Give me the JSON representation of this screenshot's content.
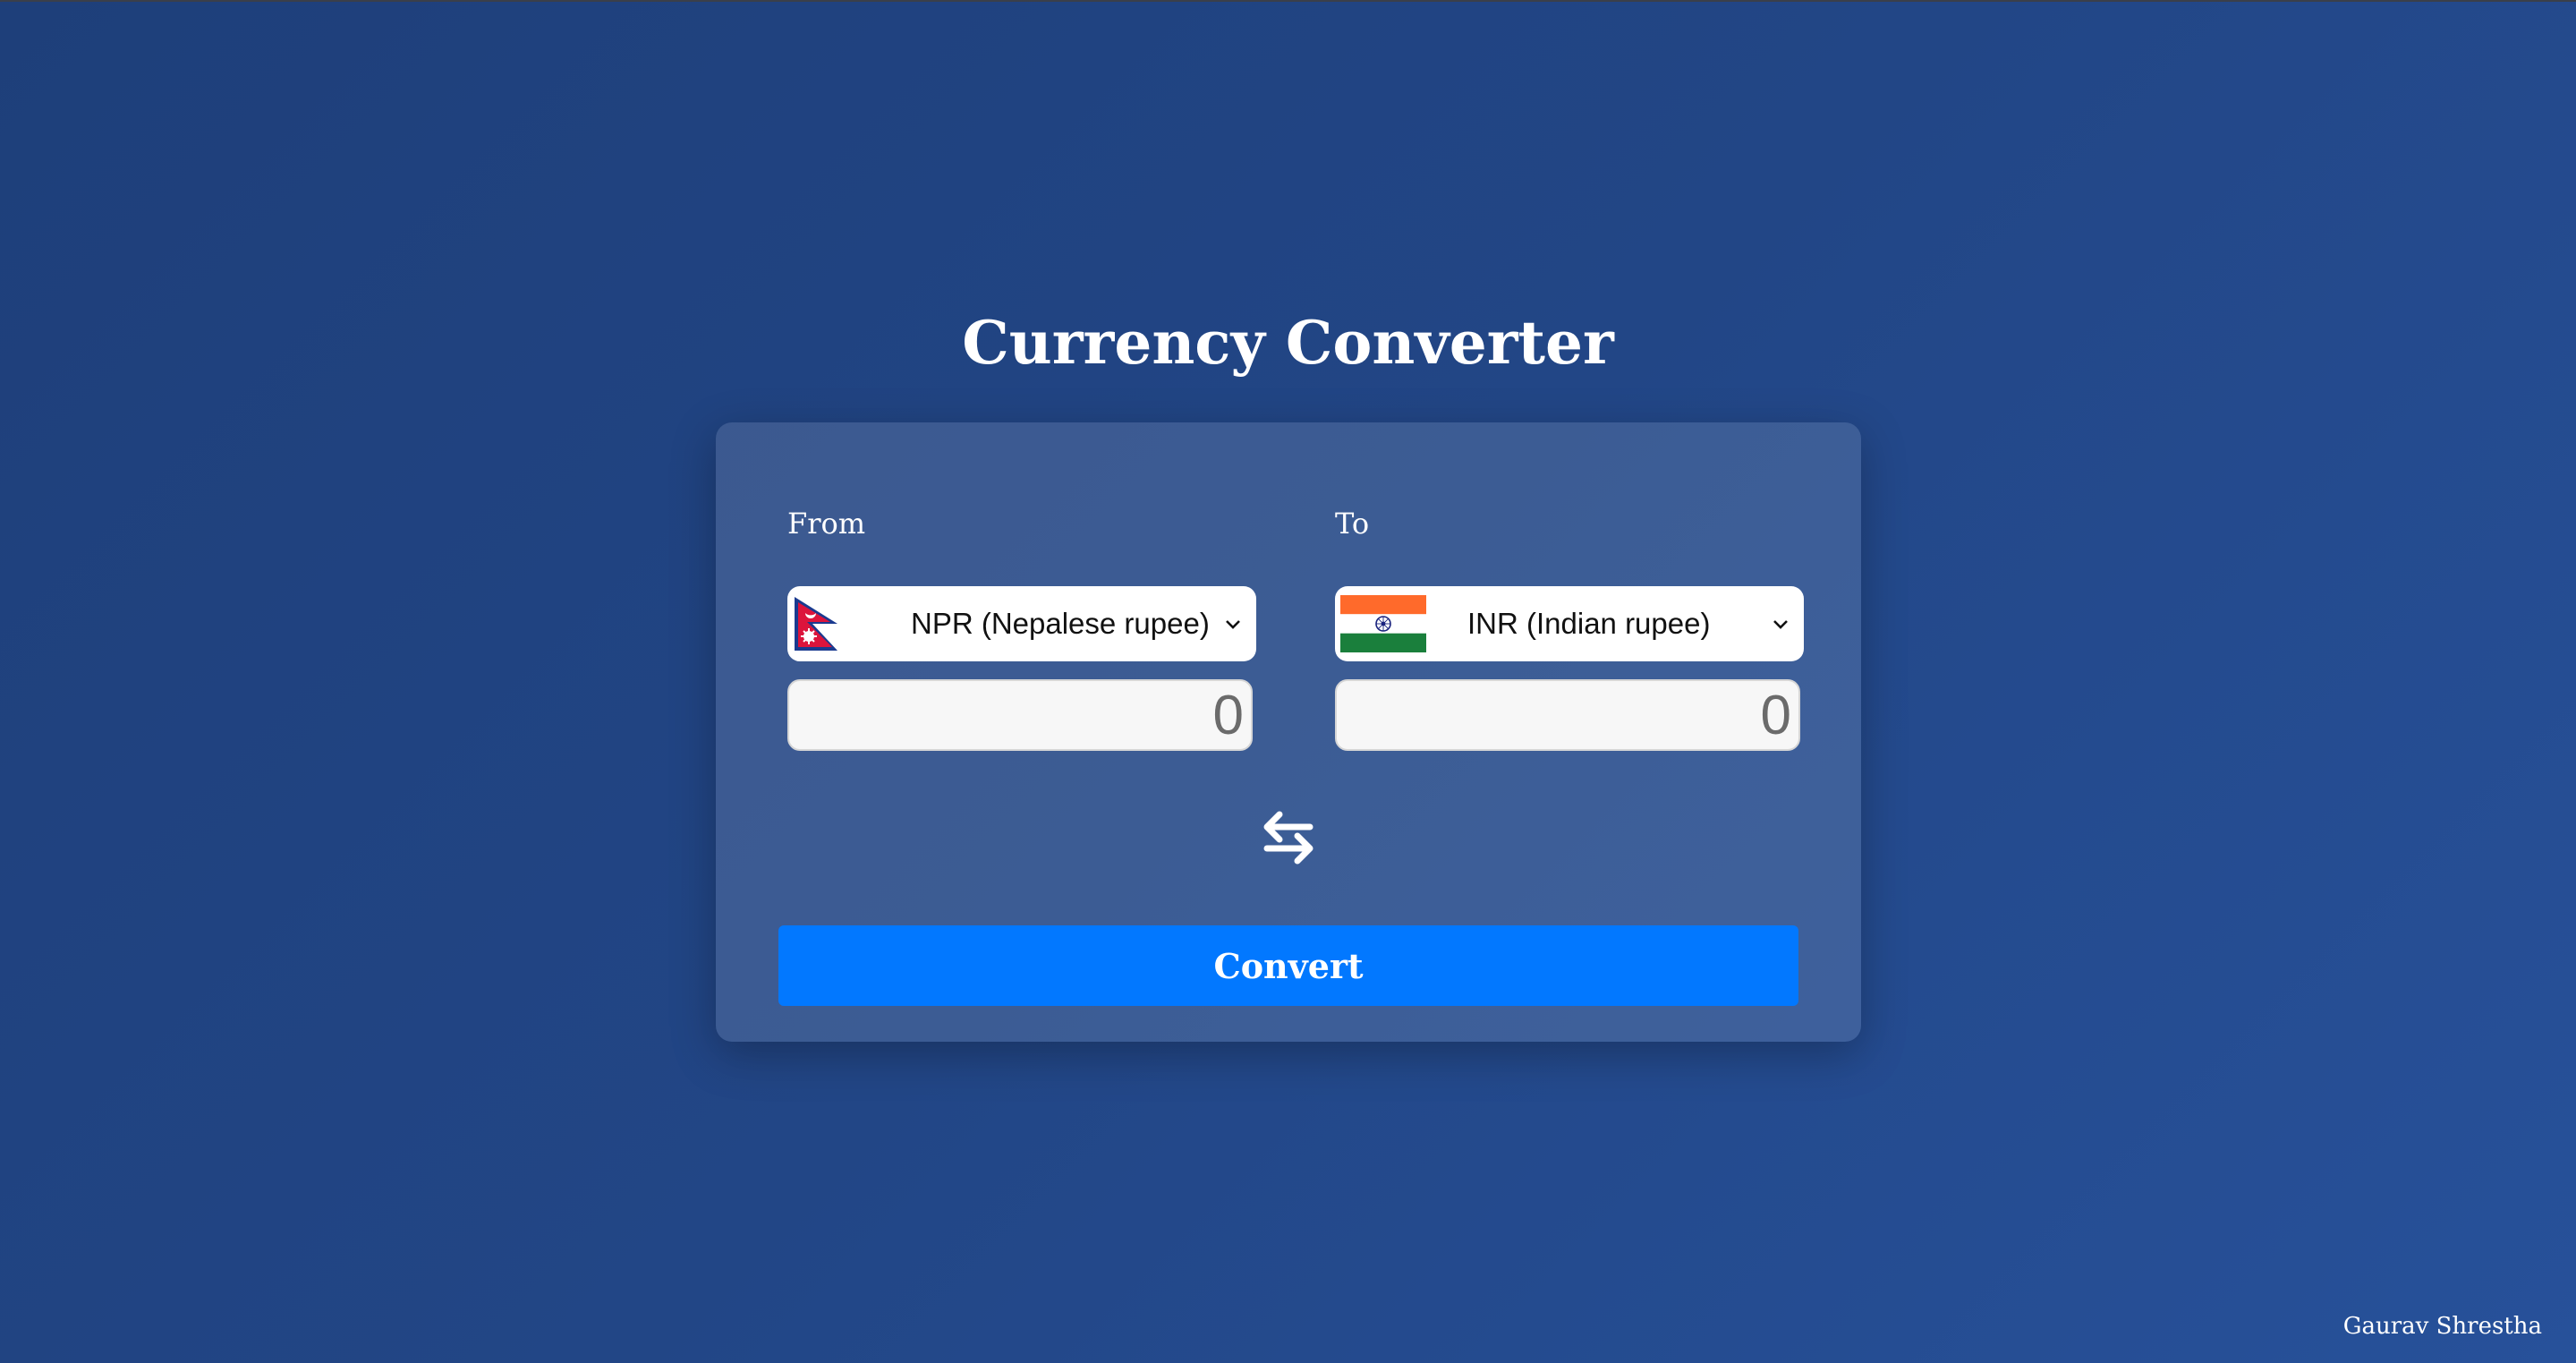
{
  "app": {
    "title": "Currency Converter",
    "footer": "Gaurav Shrestha"
  },
  "from": {
    "label": "From",
    "currency": "NPR (Nepalese rupee)",
    "flag_icon": "nepal-flag-icon",
    "amount_placeholder": "0",
    "amount_value": ""
  },
  "to": {
    "label": "To",
    "currency": "INR (Indian rupee)",
    "flag_icon": "india-flag-icon",
    "amount_placeholder": "0",
    "amount_value": ""
  },
  "actions": {
    "swap_icon": "swap-arrows-icon",
    "convert_label": "Convert"
  },
  "colors": {
    "background": "#224686",
    "card": "#3b5a91",
    "accent": "#0278ff"
  }
}
